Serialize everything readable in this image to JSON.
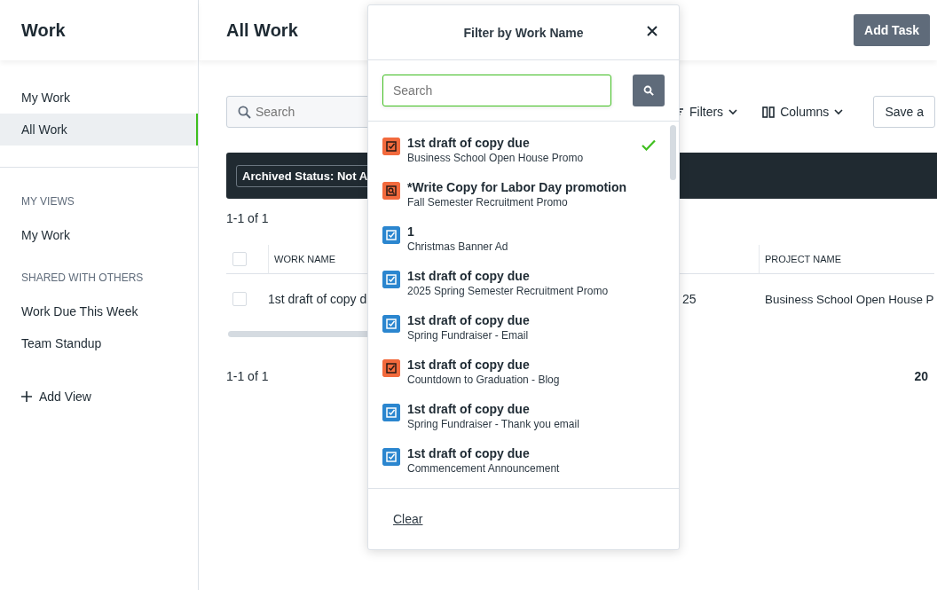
{
  "sidebar": {
    "title": "Work",
    "items": [
      {
        "label": "My Work",
        "selected": false
      },
      {
        "label": "All Work",
        "selected": true
      }
    ],
    "sections": [
      {
        "heading": "MY VIEWS",
        "items": [
          {
            "label": "My Work",
            "selected": false
          }
        ]
      },
      {
        "heading": "SHARED WITH OTHERS",
        "items": [
          {
            "label": "Work Due This Week",
            "selected": false
          },
          {
            "label": "Team Standup",
            "selected": false
          }
        ]
      }
    ],
    "add_view": "Add View"
  },
  "main": {
    "title": "All Work",
    "add_task": "Add Task",
    "search_placeholder": "Search",
    "filters": "Filters",
    "columns_button": "Columns",
    "save_button": "Save a",
    "filter_chip": "Archived Status: Not A",
    "count_top": "1-1 of 1",
    "table": {
      "header_checked": false,
      "columns": [
        "WORK NAME",
        "PROJECT NAME"
      ],
      "rows": [
        {
          "selected": false,
          "work_name": "1st draft of copy d",
          "column_3": "25",
          "project_name": "Business School Open House P"
        }
      ]
    },
    "count_bottom": "1-1 of 1",
    "page_size": "20"
  },
  "popover": {
    "title": "Filter by Work Name",
    "search_placeholder": "Search",
    "items": [
      {
        "title": "1st draft of copy due",
        "subtitle": "Business School Open House Promo",
        "kind": "check",
        "color": "#f26a3d",
        "selected": true
      },
      {
        "title": "*Write Copy for Labor Day promotion",
        "subtitle": "Fall Semester Recruitment Promo",
        "kind": "search",
        "color": "#f26a3d",
        "selected": false
      },
      {
        "title": "1",
        "subtitle": "Christmas Banner Ad",
        "kind": "check",
        "color": "#2b86cf",
        "selected": false
      },
      {
        "title": "1st draft of copy due",
        "subtitle": "2025 Spring Semester Recruitment Promo",
        "kind": "check",
        "color": "#2b86cf",
        "selected": false
      },
      {
        "title": "1st draft of copy due",
        "subtitle": "Spring Fundraiser - Email",
        "kind": "check",
        "color": "#2b86cf",
        "selected": false
      },
      {
        "title": "1st draft of copy due",
        "subtitle": "Countdown to Graduation - Blog",
        "kind": "check",
        "color": "#f26a3d",
        "selected": false
      },
      {
        "title": "1st draft of copy due",
        "subtitle": "Spring Fundraiser - Thank you email",
        "kind": "check",
        "color": "#2b86cf",
        "selected": false
      },
      {
        "title": "1st draft of copy due",
        "subtitle": "Commencement Announcement",
        "kind": "check",
        "color": "#2b86cf",
        "selected": false
      }
    ],
    "clear": "Clear"
  }
}
